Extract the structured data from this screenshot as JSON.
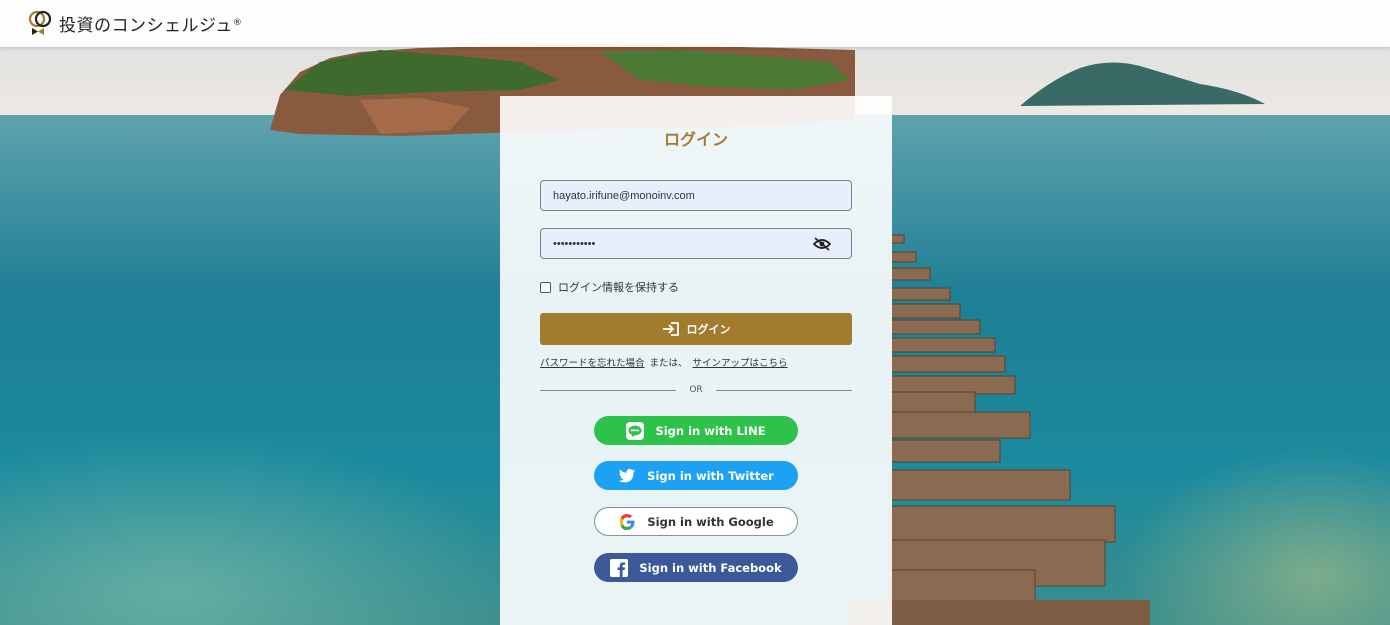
{
  "header": {
    "logo_text": "投資のコンシェルジュ",
    "logo_reg": "®"
  },
  "login": {
    "title": "ログイン",
    "email_value": "hayato.irifune@monoinv.com",
    "password_value": "•••••••••••",
    "remember_label": "ログイン情報を保持する",
    "login_button_label": "ログイン",
    "forgot_password_link": "パスワードを忘れた場合",
    "or_text_inline": "または、",
    "signup_link": "サインアップはこちら",
    "divider_text": "OR"
  },
  "social": {
    "line_label": "Sign in with LINE",
    "twitter_label": "Sign in with Twitter",
    "google_label": "Sign in with Google",
    "facebook_label": "Sign in with Facebook"
  },
  "colors": {
    "brand_gold": "#a27b2e",
    "line_green": "#2fc24b",
    "twitter_blue": "#1da1f2",
    "facebook_blue": "#3b5998"
  }
}
